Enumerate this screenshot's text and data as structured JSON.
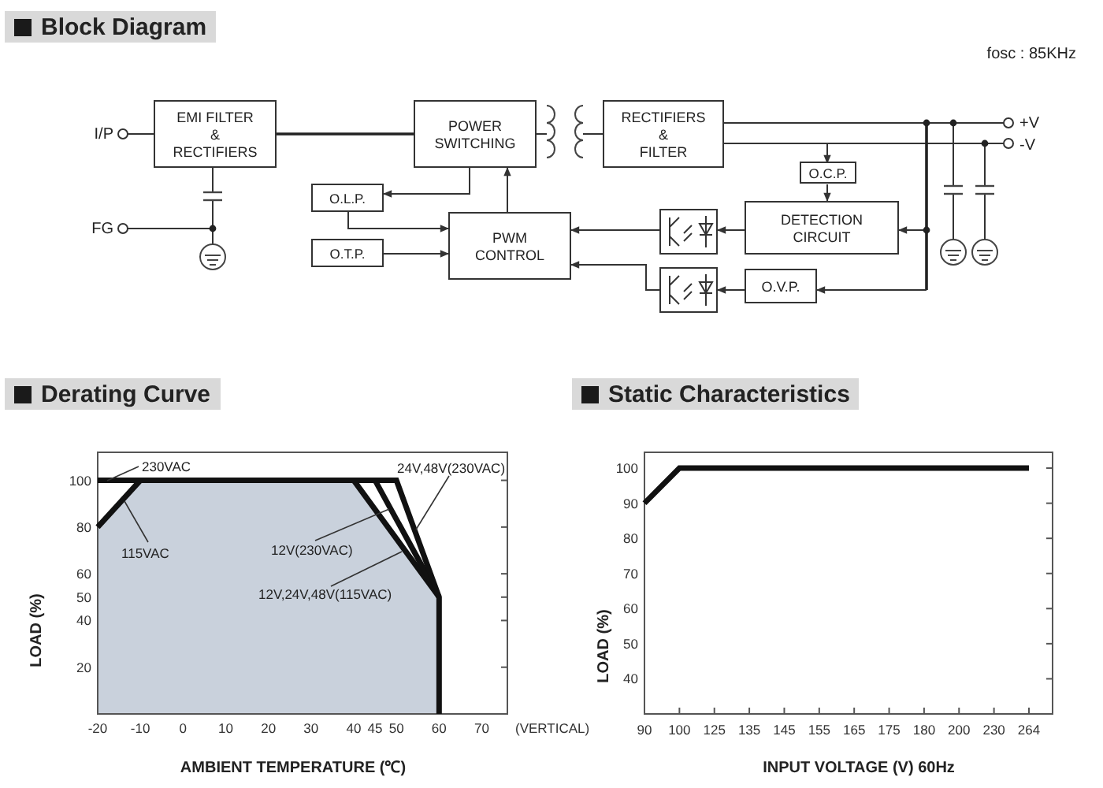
{
  "block_diagram": {
    "title": "Block Diagram",
    "note": "fosc : 85KHz",
    "terminals": [
      {
        "label": "I/P"
      },
      {
        "label": "FG"
      },
      {
        "label": "+V"
      },
      {
        "label": "-V"
      }
    ],
    "blocks": [
      {
        "lines": [
          "EMI FILTER",
          "&",
          "RECTIFIERS"
        ]
      },
      {
        "lines": [
          "POWER",
          "SWITCHING"
        ]
      },
      {
        "lines": [
          "RECTIFIERS",
          "&",
          "FILTER"
        ]
      },
      {
        "lines": [
          "O.C.P."
        ]
      },
      {
        "lines": [
          "O.L.P."
        ]
      },
      {
        "lines": [
          "O.T.P."
        ]
      },
      {
        "lines": [
          "PWM",
          "CONTROL"
        ]
      },
      {
        "lines": [
          "DETECTION",
          "CIRCUIT"
        ]
      },
      {
        "lines": [
          "O.V.P."
        ]
      }
    ]
  },
  "derating_curve": {
    "title": "Derating Curve",
    "axis_note": "(VERTICAL)",
    "chart_data": {
      "type": "line",
      "xlabel": "AMBIENT TEMPERATURE (℃)",
      "ylabel": "LOAD (%)",
      "x": [
        -20,
        -10,
        40,
        45,
        50,
        60,
        60
      ],
      "series": [
        {
          "color": "#111111",
          "values": [
            80,
            100,
            100,
            87.5,
            75,
            50,
            null
          ]
        },
        {
          "color": "#111111",
          "values": [
            null,
            null,
            null,
            100,
            83.3,
            50,
            null
          ]
        },
        {
          "color": "#111111",
          "values": [
            100,
            100,
            100,
            100,
            100,
            50,
            0
          ]
        }
      ],
      "xlim": [
        -20,
        76
      ],
      "ylim": [
        0,
        112
      ],
      "xticks": [
        -20,
        -10,
        0,
        10,
        20,
        30,
        40,
        45,
        50,
        60,
        70
      ],
      "yticks": [
        20,
        40,
        50,
        60,
        80,
        100
      ],
      "annotations": [
        "230VAC",
        "115VAC",
        "12V(230VAC)",
        "24V,48V(230VAC)",
        "12V,24V,48V(115VAC)"
      ]
    }
  },
  "static_characteristics": {
    "title": "Static Characteristics",
    "chart_data": {
      "type": "line",
      "xlabel": "INPUT VOLTAGE (V) 60Hz",
      "ylabel": "LOAD (%)",
      "categories": [
        "90",
        "100",
        "125",
        "135",
        "145",
        "155",
        "165",
        "175",
        "180",
        "200",
        "230",
        "264"
      ],
      "series": [
        {
          "color": "#111111",
          "values": [
            90,
            100,
            100,
            100,
            100,
            100,
            100,
            100,
            100,
            100,
            100,
            100
          ]
        }
      ],
      "ylim": [
        30,
        104.5
      ],
      "yticks": [
        40,
        50,
        60,
        70,
        80,
        90,
        100
      ]
    }
  }
}
